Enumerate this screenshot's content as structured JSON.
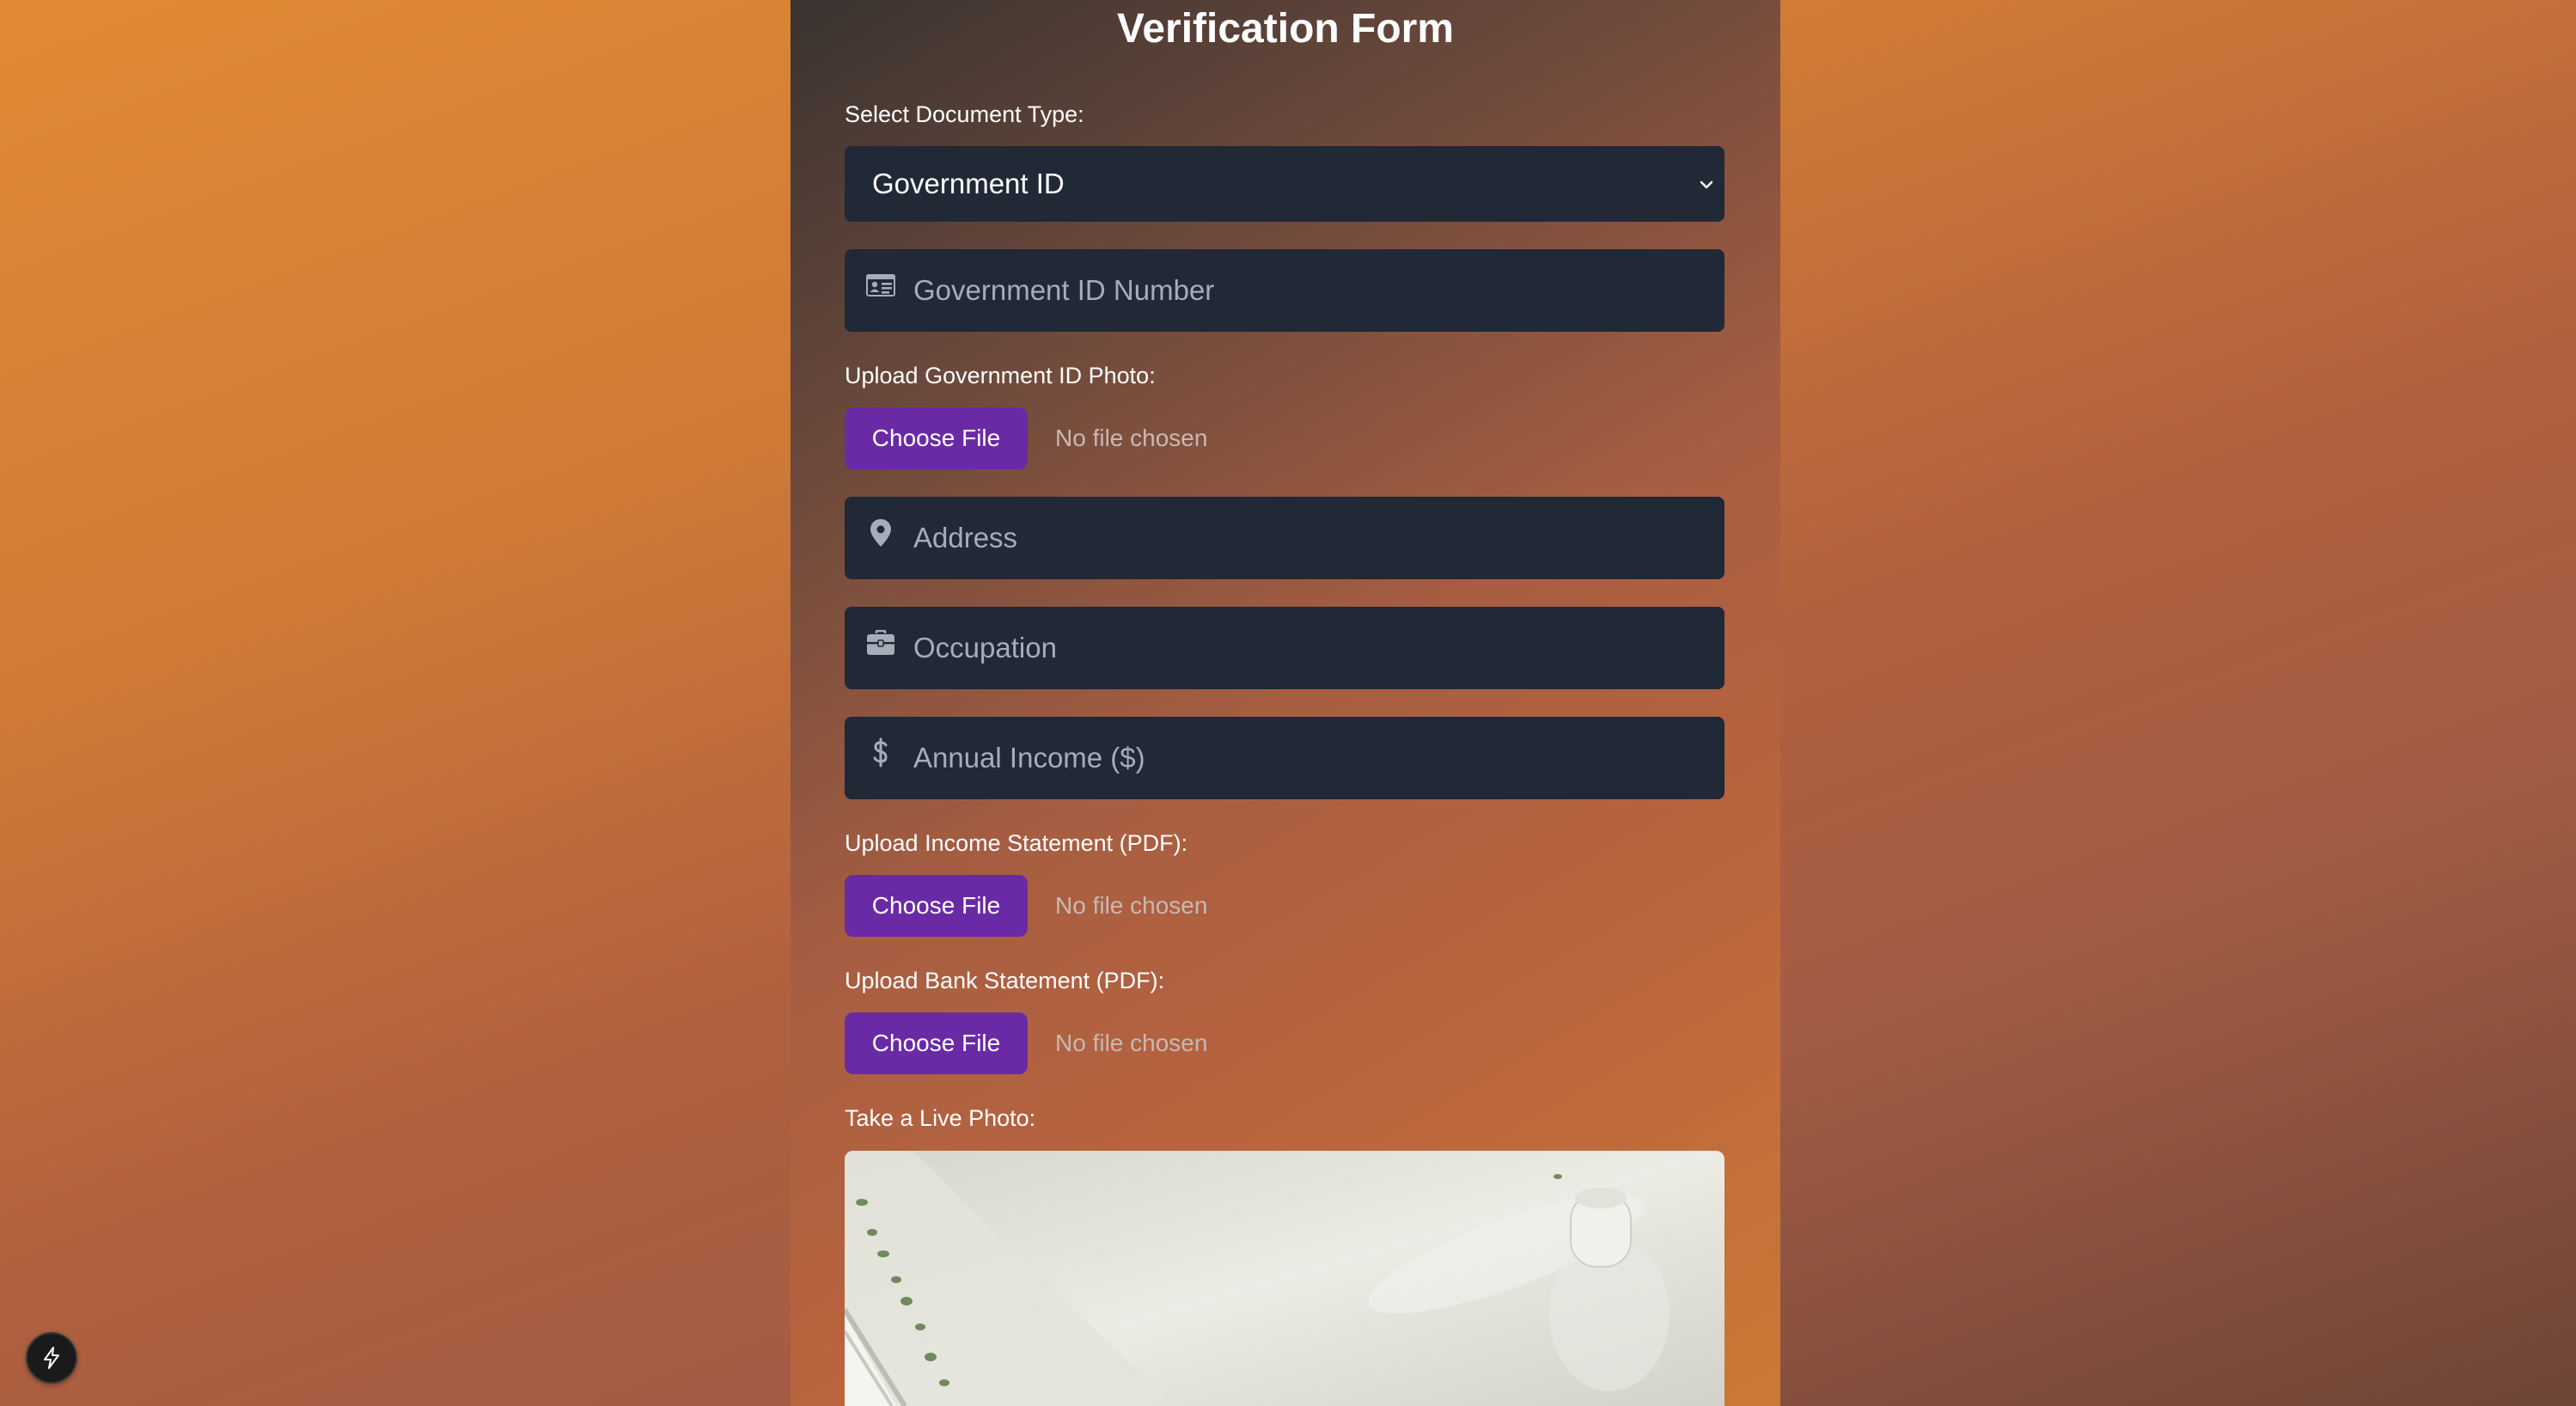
{
  "form": {
    "title": "Verification Form",
    "document_type_label": "Select Document Type:",
    "document_type_value": "Government ID",
    "gov_id_placeholder": "Government ID Number",
    "upload_gov_id_label": "Upload Government ID Photo:",
    "address_placeholder": "Address",
    "occupation_placeholder": "Occupation",
    "income_placeholder": "Annual Income ($)",
    "upload_income_label": "Upload Income Statement (PDF):",
    "upload_bank_label": "Upload Bank Statement (PDF):",
    "live_photo_label": "Take a Live Photo:"
  },
  "file_inputs": {
    "button_label": "Choose File",
    "status": "No file chosen"
  },
  "icons": {
    "id_card": "id-card-icon",
    "location": "map-pin-icon",
    "occupation": "briefcase-icon",
    "income": "dollar-icon",
    "dropdown": "chevron-down-icon",
    "dev_badge": "lightning-bolt-icon"
  },
  "colors": {
    "field_bg": "#212836",
    "button_bg": "#6a2aa6",
    "placeholder": "#a7adb8",
    "text": "#ffffff"
  }
}
